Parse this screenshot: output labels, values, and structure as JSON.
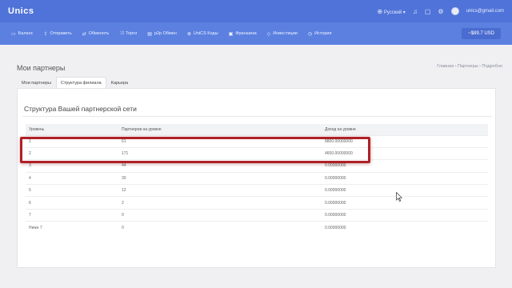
{
  "header": {
    "logo": "Unics",
    "language": "Русский",
    "user_email": "unics@gmail.com"
  },
  "nav": {
    "items": [
      {
        "label": "Баланс",
        "icon": "wallet-icon",
        "glyph": "▭"
      },
      {
        "label": "Отправить",
        "icon": "upload-icon",
        "glyph": "⇪"
      },
      {
        "label": "Обменять",
        "icon": "exchange-icon",
        "glyph": "⇄"
      },
      {
        "label": "Торги",
        "icon": "trade-icon",
        "glyph": "⤨"
      },
      {
        "label": "p2p Обмен",
        "icon": "p2p-icon",
        "glyph": "▤"
      },
      {
        "label": "UniCS Коды",
        "icon": "globe-icon",
        "glyph": "⊕"
      },
      {
        "label": "Франшиза",
        "icon": "franchise-icon",
        "glyph": "▣"
      },
      {
        "label": "Инвестиции",
        "icon": "diamond-icon",
        "glyph": "◇"
      },
      {
        "label": "История",
        "icon": "clock-icon",
        "glyph": "◷"
      }
    ],
    "balance": "~$89.7 USD"
  },
  "page": {
    "title": "Мои партнеры",
    "breadcrumb": "Главная › Партнеры › Подробно"
  },
  "tabs": [
    {
      "label": "Мои партнеры",
      "active": false
    },
    {
      "label": "Структура филиала",
      "active": true
    },
    {
      "label": "Карьера",
      "active": false
    }
  ],
  "card": {
    "title": "Структура Вашей партнерской сети",
    "columns": [
      "Уровень",
      "Партнеров на уровне",
      "Доход на уровне"
    ],
    "rows": [
      [
        "1",
        "61",
        "8800.00000000"
      ],
      [
        "2",
        "171",
        "4600.00000000"
      ],
      [
        "3",
        "44",
        "0.00000000"
      ],
      [
        "4",
        "30",
        "0.00000000"
      ],
      [
        "5",
        "12",
        "0.00000000"
      ],
      [
        "6",
        "2",
        "0.00000000"
      ],
      [
        "7",
        "0",
        "0.00000000"
      ],
      [
        "Ниже 7",
        "0",
        "0.00000000"
      ]
    ]
  },
  "colors": {
    "header_bg": "#4f73d8",
    "nav_bg": "#5b80e0",
    "highlight": "#b02026"
  }
}
